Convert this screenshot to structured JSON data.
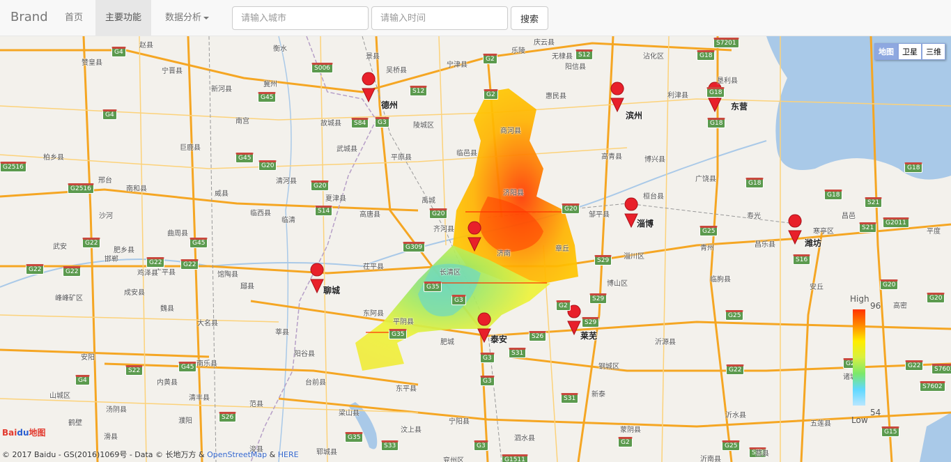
{
  "navbar": {
    "brand": "Brand",
    "items": [
      {
        "label": "首页"
      },
      {
        "label": "主要功能"
      },
      {
        "label": "数据分析"
      }
    ],
    "city_placeholder": "请输入城市",
    "time_placeholder": "请输入时间",
    "search_label": "搜索"
  },
  "map": {
    "type_buttons": [
      "地图",
      "卫星",
      "三维"
    ],
    "markers": [
      "德州",
      "滨州",
      "东营",
      "淄博",
      "潍坊",
      "济南",
      "聊城",
      "泰安",
      "莱芜"
    ],
    "place_labels": [
      "衡水",
      "邢台",
      "邯郸",
      "安阳",
      "鹤壁",
      "濮阳",
      "赵县",
      "赞皇县",
      "宁晋县",
      "新河县",
      "冀州",
      "南宫",
      "巨鹿县",
      "柏乡县",
      "南和县",
      "沙河",
      "威县",
      "临西县",
      "临清",
      "清河县",
      "夏津县",
      "高唐县",
      "武城县",
      "故城县",
      "景县",
      "吴桥县",
      "宁津县",
      "乐陵",
      "庆云县",
      "无棣县",
      "阳信县",
      "沾化区",
      "惠民县",
      "陵城区",
      "平原县",
      "临邑县",
      "商河县",
      "济阳县",
      "高青县",
      "博兴县",
      "广饶县",
      "利津县",
      "垦利县",
      "桓台县",
      "邹平县",
      "章丘",
      "淄川区",
      "博山区",
      "齐河县",
      "长清区",
      "禹城",
      "茌平县",
      "东阿县",
      "平阴县",
      "肥城",
      "阳谷县",
      "莘县",
      "冠县",
      "馆陶县",
      "大名县",
      "魏县",
      "成安县",
      "肥乡县",
      "广平县",
      "峰峰矿区",
      "武安",
      "曲周县",
      "邱县",
      "鸡泽县",
      "内黄县",
      "清丰县",
      "南乐县",
      "范县",
      "台前县",
      "梁山县",
      "东平县",
      "汶上县",
      "宁阳县",
      "泗水县",
      "新泰",
      "蒙阴县",
      "沂源县",
      "临朐县",
      "青州",
      "寿光",
      "昌乐县",
      "安丘",
      "寒亭区",
      "昌邑",
      "平度",
      "高密",
      "诸城",
      "沂水县",
      "五莲县",
      "莒县",
      "沂南县",
      "钢城区",
      "兖州区",
      "郓城县",
      "山城区",
      "汤阴县",
      "滑县",
      "浚县",
      "济南"
    ],
    "legend": {
      "high_label": "High",
      "high_value": "96",
      "low_label": "Low",
      "low_value": "54"
    },
    "copyright": {
      "prefix": "© 2017 Baidu - GS(2016)1069号 - Data © 长地万方 & ",
      "link1": "OpenStreetMap",
      "amp": " & ",
      "link2": "HERE"
    },
    "logo_text1": "Bai",
    "logo_text2": "du",
    "logo_text3": "地图"
  },
  "colors": {
    "heat_high": "#ff4a00",
    "heat_mid": "#ffe000",
    "heat_low": "#5fe0c0",
    "marker": "#e8202a",
    "road_major": "#f5a623",
    "water": "#a9c9e8"
  }
}
